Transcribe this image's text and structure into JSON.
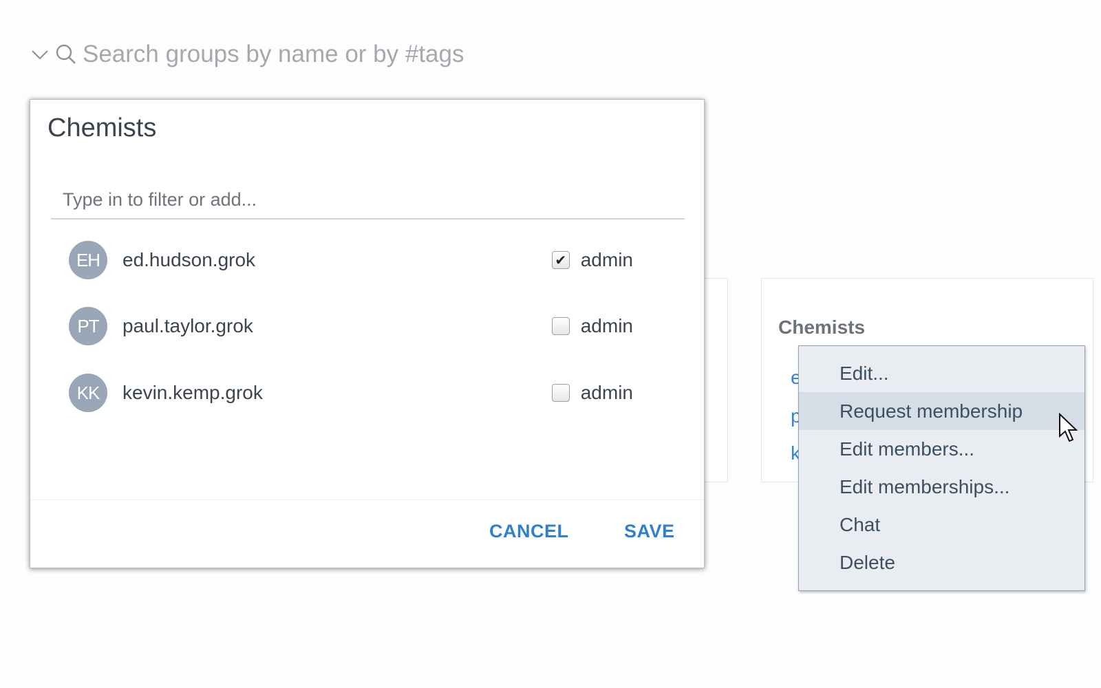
{
  "search": {
    "placeholder": "Search groups by name or by #tags",
    "icons": [
      "chevron-down-icon",
      "search-icon"
    ]
  },
  "dialog": {
    "title": "Chemists",
    "filter_placeholder": "Type in to filter or add...",
    "members": [
      {
        "initials": "EH",
        "name": "ed.hudson.grok",
        "admin_label": "admin",
        "admin": true
      },
      {
        "initials": "PT",
        "name": "paul.taylor.grok",
        "admin_label": "admin",
        "admin": false
      },
      {
        "initials": "KK",
        "name": "kevin.kemp.grok",
        "admin_label": "admin",
        "admin": false
      }
    ],
    "cancel": "CANCEL",
    "save": "SAVE"
  },
  "group_card": {
    "title": "Chemists",
    "member_initial_letters": [
      "e",
      "p",
      "k"
    ]
  },
  "context_menu": {
    "items": [
      "Edit...",
      "Request membership",
      "Edit members...",
      "Edit memberships...",
      "Chat",
      "Delete"
    ],
    "highlighted": 1
  },
  "colors": {
    "accent": "#2f7fd2",
    "avatar": "#98a6b6",
    "menu_bg": "#e9edf1",
    "menu_highlight": "#d5dde6"
  }
}
